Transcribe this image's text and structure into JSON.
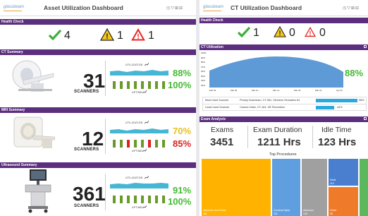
{
  "left": {
    "logo": "glassbeam",
    "title": "Asset Utilization Dashboard",
    "health_check": {
      "label": "Health Check",
      "ok": "4",
      "warning": "1",
      "critical": "1"
    },
    "ct": {
      "label": "CT Summary",
      "count": "31",
      "unit": "SCANNERS",
      "utilization_label": "UTILIZATION",
      "uptime_label": "UPTIME",
      "utilization_pct": "88%",
      "uptime_pct": "100%",
      "util_color": "#44bb33",
      "uptime_color": "#44bb33"
    },
    "mri": {
      "label": "MRI Summary",
      "count": "12",
      "unit": "SCANNERS",
      "utilization_label": "UTILIZATION",
      "uptime_label": "UPTIME",
      "utilization_pct": "70%",
      "uptime_pct": "85%",
      "util_color": "#e6c21b",
      "uptime_color": "#dd2222"
    },
    "us": {
      "label": "Ultrasound Summary",
      "count": "361",
      "unit": "SCANNERS",
      "utilization_label": "UTILIZATION",
      "uptime_label": "UPTIME",
      "utilization_pct": "91%",
      "uptime_pct": "100%",
      "util_color": "#44bb33",
      "uptime_color": "#44bb33"
    }
  },
  "right": {
    "logo": "glassbeam",
    "title": "CT Utilization Dashboard",
    "health_check": {
      "label": "Health Check",
      "ok": "1",
      "warning": "0",
      "critical": "0"
    },
    "ct_utilization": {
      "label": "CT Utilization",
      "pct": "88%",
      "yticks": [
        "100%",
        "90%",
        "80%",
        "70%",
        "60%",
        "50%",
        "40%",
        "30%"
      ],
      "xticks": [
        "Mar 02",
        "Mar 06",
        "Mar 10",
        "Mar 14",
        "Mar 18",
        "Mar 22",
        "Apr 02"
      ]
    },
    "scanner_table": [
      {
        "label": "Most Used Scanner",
        "value": "Presby Downtown, CT-081, Siemens Sensation 64",
        "pct": "98%",
        "fill": 0.98
      },
      {
        "label": "Least Used Scanner",
        "value": "Carmen Main, CT-164, GE Revolution",
        "pct": "44%",
        "fill": 0.44
      }
    ],
    "exam_analysis": {
      "label": "Exam Analysis",
      "exams_label": "Exams",
      "exams_value": "3451",
      "duration_label": "Exam Duration",
      "duration_value": "1211 Hrs",
      "idle_label": "Idle Time",
      "idle_value": "123 Hrs"
    },
    "top_procedures": {
      "title": "Top Procedures",
      "tiles": [
        {
          "label": "Abdomen and Pelvis",
          "value": "361",
          "color": "#ffb300"
        },
        {
          "label": "Cerebral Spine",
          "value": "231",
          "color": "#5f9fe0"
        },
        {
          "label": "Abdomen",
          "value": "140",
          "color": "#a0a0a0"
        },
        {
          "label": "Head",
          "value": "119",
          "color": "#4a7fd0"
        },
        {
          "label": "Chest",
          "value": "98",
          "color": "#ef7b2a"
        },
        {
          "label": "",
          "value": "",
          "color": "#5cb85c"
        }
      ]
    }
  }
}
